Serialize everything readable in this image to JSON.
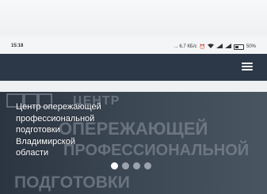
{
  "status_bar": {
    "time": "15:18",
    "network_speed": "... 6,7 КБ/с",
    "battery_level": "50%",
    "battery_fill": 0.5
  },
  "header": {
    "menu_icon": "hamburger-menu-icon"
  },
  "hero": {
    "heading_lines": [
      "Центр опережающей",
      "профессиональной",
      "подготовки",
      "Владимирской",
      "области"
    ],
    "background_logo_lines": [
      "ЦЕНТР",
      "ОПЕРЕЖАЮЩЕЙ",
      "ПРОФЕССИОНАЛЬНОЙ",
      "ПОДГОТОВКИ"
    ],
    "slider": {
      "count": 4,
      "active_index": 0
    }
  },
  "colors": {
    "navbar": "#2c3847",
    "hero_bg": "#3b4653",
    "dot_active": "#ffffff",
    "dot_inactive": "#9aa3ad"
  }
}
